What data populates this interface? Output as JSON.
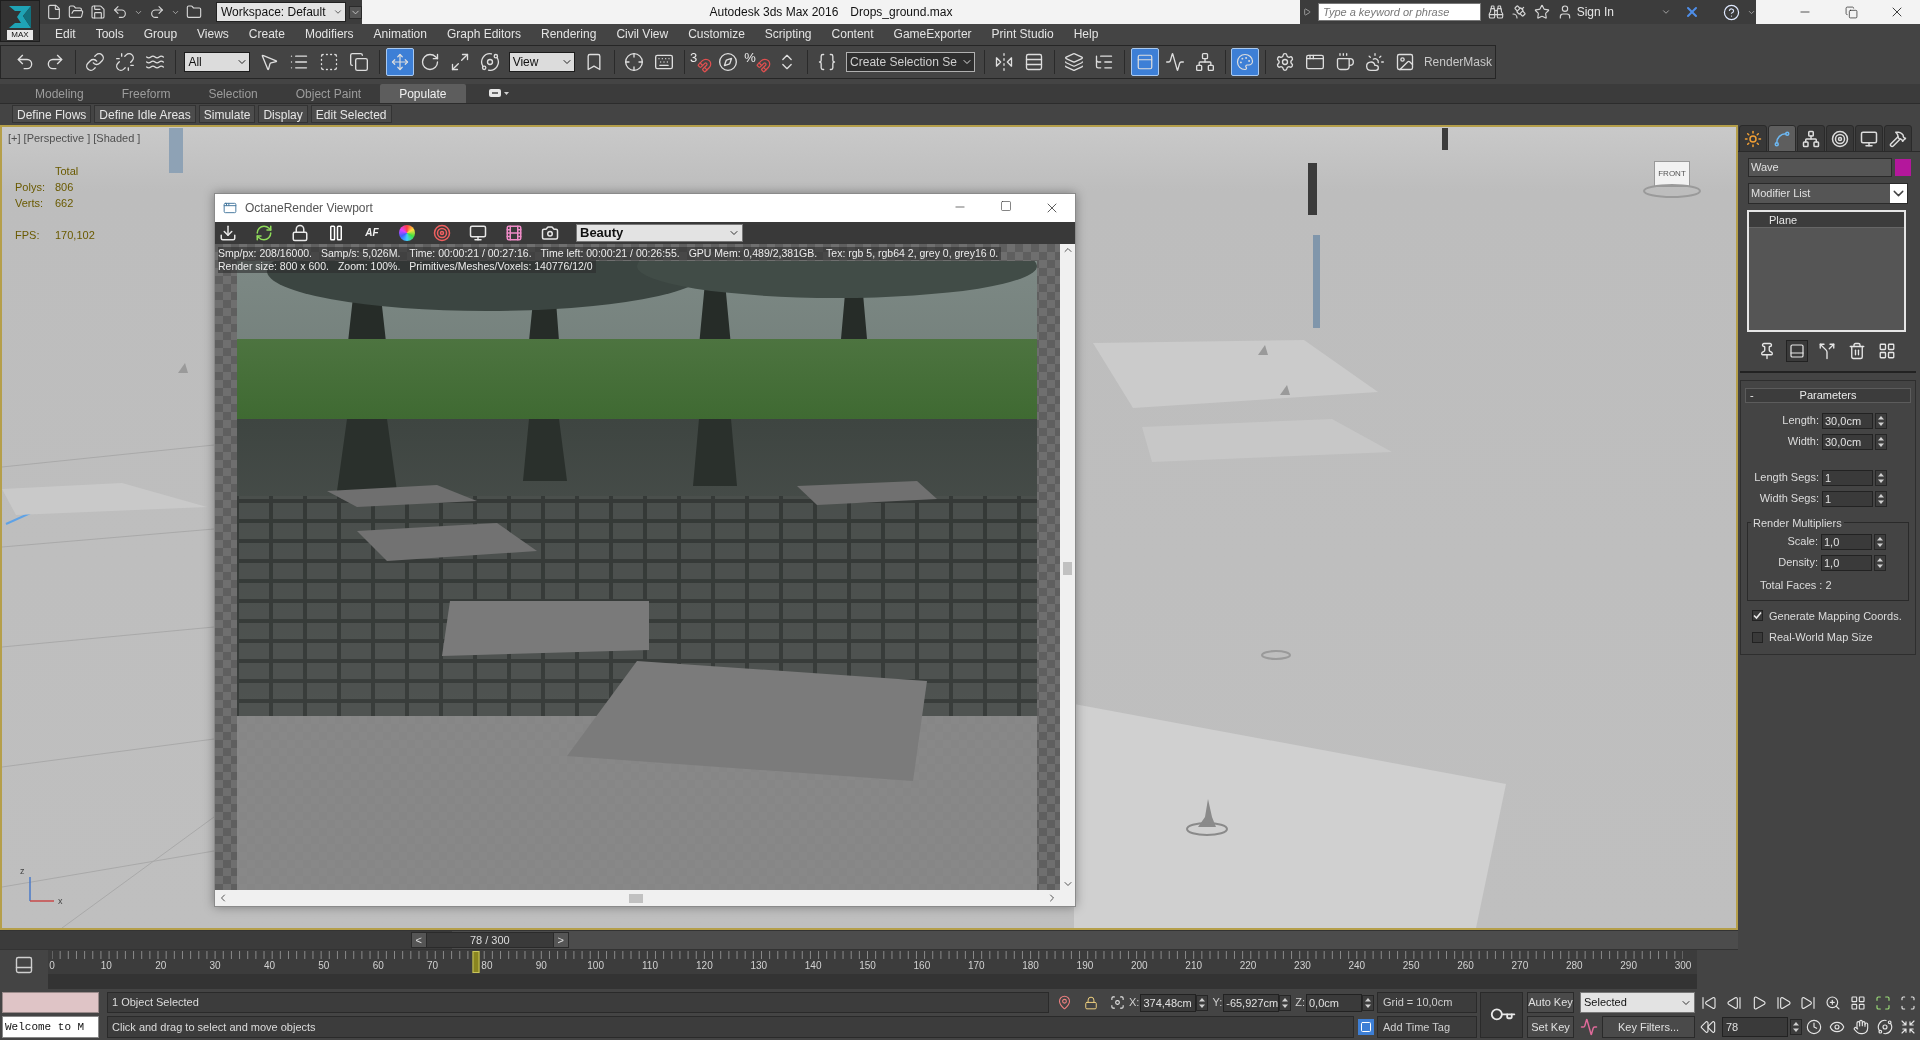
{
  "title_bar": {
    "logo": "MAX",
    "workspace": "Workspace: Default",
    "app_name": "Autodesk 3ds Max 2016",
    "file_name": "Drops_ground.max",
    "search": {
      "placeholder": "Type a keyword or phrase"
    },
    "sign_in": "Sign In"
  },
  "menu": [
    "Edit",
    "Tools",
    "Group",
    "Views",
    "Create",
    "Modifiers",
    "Animation",
    "Graph Editors",
    "Rendering",
    "Civil View",
    "Customize",
    "Scripting",
    "Content",
    "GameExporter",
    "Print Studio",
    "Help"
  ],
  "main_toolbar": [
    [
      {
        "kind": "undo",
        "active": false
      },
      {
        "kind": "redo",
        "active": false
      }
    ],
    [
      {
        "kind": "link",
        "active": false
      },
      {
        "kind": "unlink",
        "active": false
      },
      {
        "kind": "bind",
        "active": false
      }
    ],
    [
      {
        "kind": "dropdown",
        "value": "All"
      },
      {
        "kind": "select",
        "active": false
      },
      {
        "kind": "select_by_name",
        "active": false
      },
      {
        "kind": "region",
        "active": false
      },
      {
        "kind": "crossing",
        "active": false
      }
    ],
    [
      {
        "kind": "move",
        "active": true
      },
      {
        "kind": "rotate",
        "active": false
      },
      {
        "kind": "scale",
        "active": false
      },
      {
        "kind": "place",
        "active": false
      },
      {
        "kind": "dropdown",
        "value": "View"
      },
      {
        "kind": "pivot",
        "active": false
      }
    ],
    [
      {
        "kind": "manipulate",
        "active": false
      },
      {
        "kind": "shortcut",
        "active": false
      }
    ],
    [
      {
        "kind": "snap",
        "label": "3",
        "active": false
      },
      {
        "kind": "angle_snap",
        "active": false
      },
      {
        "kind": "snap",
        "label": "%",
        "active": false
      },
      {
        "kind": "spinner_snap",
        "active": false
      }
    ],
    [
      {
        "kind": "named_sets",
        "active": false
      },
      {
        "kind": "combo",
        "value": "Create Selection Se"
      }
    ],
    [
      {
        "kind": "mirror",
        "active": false
      },
      {
        "kind": "align",
        "active": false
      }
    ],
    [
      {
        "kind": "layers",
        "active": false
      },
      {
        "kind": "scene_explorer",
        "active": false
      }
    ],
    [
      {
        "kind": "ribbon",
        "active": true
      },
      {
        "kind": "curve_editor",
        "active": false
      },
      {
        "kind": "schematic",
        "active": false
      }
    ],
    [
      {
        "kind": "material_editor",
        "active": true
      }
    ],
    [
      {
        "kind": "render_setup",
        "active": false
      },
      {
        "kind": "frame_window",
        "active": false
      },
      {
        "kind": "render",
        "active": false
      },
      {
        "kind": "activeshade",
        "active": false
      },
      {
        "kind": "render_mask",
        "active": false
      },
      {
        "kind": "label",
        "text": "RenderMask"
      }
    ]
  ],
  "ribbon": {
    "tabs": [
      {
        "label": "Modeling",
        "selected": false
      },
      {
        "label": "Freeform",
        "selected": false
      },
      {
        "label": "Selection",
        "selected": false
      },
      {
        "label": "Object Paint",
        "selected": false
      },
      {
        "label": "Populate",
        "selected": true
      }
    ],
    "tools": [
      "Define Flows",
      "Define Idle Areas",
      "Simulate",
      "Display",
      "Edit Selected"
    ]
  },
  "viewport": {
    "label": "[+] [Perspective ] [Shaded ]",
    "stats": {
      "header": "Total",
      "counts": [
        {
          "label": "Polys:",
          "value": "806"
        },
        {
          "label": "Verts:",
          "value": "662"
        }
      ],
      "fps": {
        "label": "FPS:",
        "value": "170,102"
      }
    },
    "viewcube": "FRONT",
    "axes": [
      "z",
      "x"
    ]
  },
  "octane": {
    "title": "OctaneRender Viewport",
    "autofocus_label": "AF",
    "pass": "Beauty",
    "stats": [
      [
        "Smp/px: 208/16000.",
        "Samp/s: 5,026M.",
        "Time: 00:00:21 / 00:27:16.",
        "Time left: 00:00:21 / 00:26:55.",
        "GPU Mem: 0,489/2,381GB.",
        "Tex: rgb 5, rgb64 2, grey 0, grey16 0."
      ],
      [
        "Render size: 800 x 600.",
        "Zoom: 100%.",
        "Primitives/Meshes/Voxels: 140776/12/0"
      ]
    ]
  },
  "command_panel": {
    "tabs": [
      {
        "kind": "create",
        "selected": false
      },
      {
        "kind": "modify",
        "selected": true
      },
      {
        "kind": "hierarchy",
        "selected": false
      },
      {
        "kind": "motion",
        "selected": false
      },
      {
        "kind": "display",
        "selected": false
      },
      {
        "kind": "utilities",
        "selected": false
      }
    ],
    "object": {
      "name": "Wave",
      "color": "#b4179c"
    },
    "modifier_list": "Modifier List",
    "stack": [
      {
        "label": "Plane",
        "selected": true
      }
    ],
    "stack_tools": [
      {
        "kind": "pin",
        "active": false
      },
      {
        "kind": "end_result",
        "active": true
      },
      {
        "kind": "make_unique",
        "active": false
      },
      {
        "kind": "remove",
        "active": false
      },
      {
        "kind": "configure",
        "active": false
      }
    ],
    "rollout": {
      "collapse": "-",
      "title": "Parameters",
      "size": [
        {
          "label": "Length:",
          "value": "30,0cm"
        },
        {
          "label": "Width:",
          "value": "30,0cm"
        }
      ],
      "segments": [
        {
          "label": "Length Segs:",
          "value": "1"
        },
        {
          "label": "Width Segs:",
          "value": "1"
        }
      ],
      "multipliers": {
        "title": "Render Multipliers",
        "fields": [
          {
            "label": "Scale:",
            "value": "1,0"
          },
          {
            "label": "Density:",
            "value": "1,0"
          }
        ],
        "total": "Total Faces : 2"
      },
      "options": [
        {
          "label": "Generate Mapping Coords.",
          "checked": true
        },
        {
          "label": "Real-World Map Size",
          "checked": false
        }
      ]
    }
  },
  "time_slider": {
    "prev": "<",
    "label": "78 / 300",
    "next": ">",
    "level": 0.26
  },
  "trackbar": {
    "labels": [
      "0",
      "10",
      "20",
      "30",
      "40",
      "50",
      "60",
      "70",
      "80",
      "90",
      "100",
      "110",
      "120",
      "130",
      "140",
      "150",
      "160",
      "170",
      "180",
      "190",
      "200",
      "210",
      "220",
      "230",
      "240",
      "250",
      "260",
      "270",
      "280",
      "290",
      "300"
    ],
    "level": 0.26
  },
  "status": {
    "listener_output": "Welcome to M",
    "selection": "1 Object Selected",
    "prompt": "Click and drag to select and move objects",
    "coordinates": [
      {
        "axis": "X:",
        "value": "374,48cm"
      },
      {
        "axis": "Y:",
        "value": "-65,927cm"
      },
      {
        "axis": "Z:",
        "value": "0,0cm"
      }
    ],
    "grid": "Grid = 10,0cm",
    "time_tag": "Add Time Tag"
  },
  "animation": {
    "auto_key": "Auto Key",
    "set_key": "Set Key",
    "key_set": "Selected",
    "key_filters": "Key Filters...",
    "frame": "78"
  }
}
